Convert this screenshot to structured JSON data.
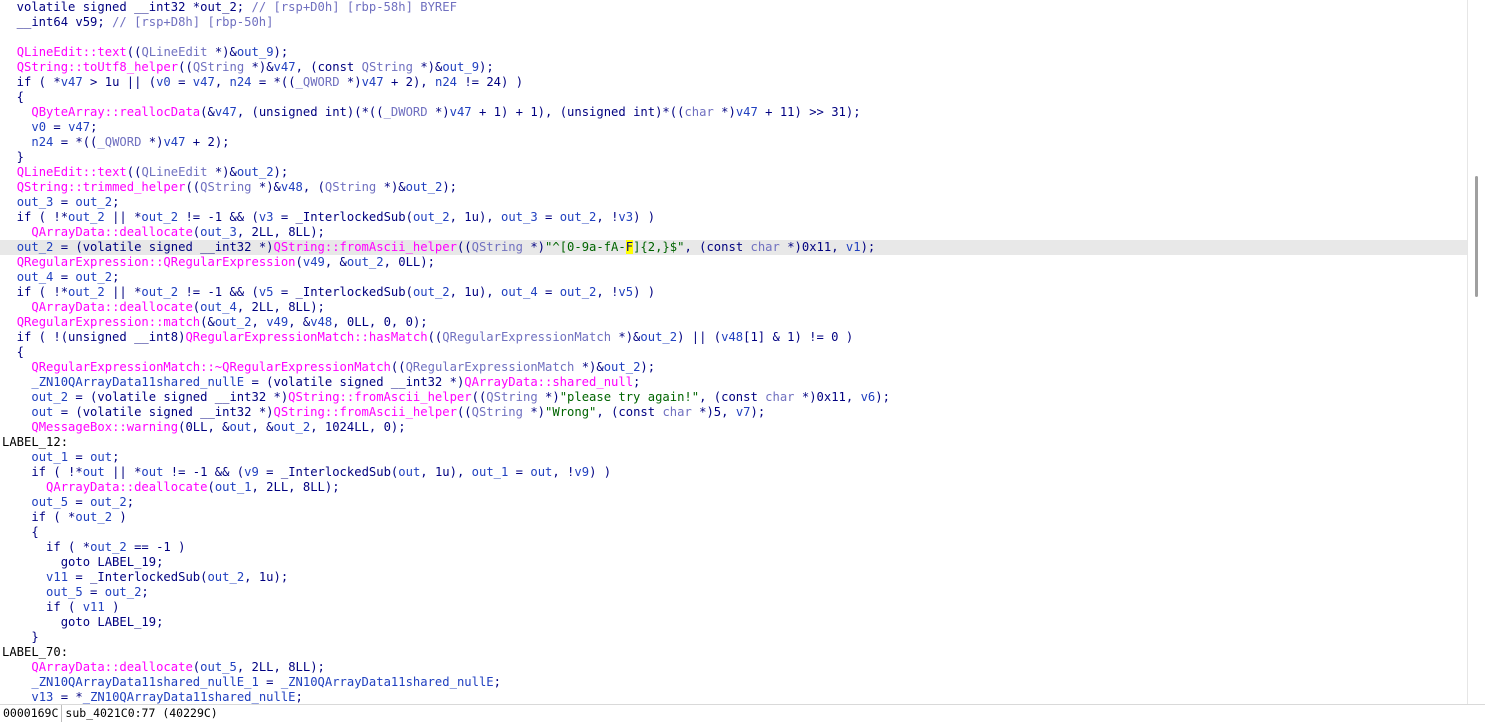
{
  "code": {
    "highlight_line": 16,
    "lines": [
      [
        [
          "  volatile signed __int32 *out_2; ",
          "p"
        ],
        [
          "// [rsp+D0h] [rbp-58h] BYREF",
          "c"
        ]
      ],
      [
        [
          "  __int64 v59; ",
          "p"
        ],
        [
          "// [rsp+D8h] [rbp-50h]",
          "c"
        ]
      ],
      [],
      [
        [
          "  ",
          "p"
        ],
        [
          "QLineEdit::text",
          "f"
        ],
        [
          "((",
          "p"
        ],
        [
          "QLineEdit",
          "c"
        ],
        [
          " *)&",
          "p"
        ],
        [
          "out_9",
          "v"
        ],
        [
          ");",
          "p"
        ]
      ],
      [
        [
          "  ",
          "p"
        ],
        [
          "QString::toUtf8_helper",
          "f"
        ],
        [
          "((",
          "p"
        ],
        [
          "QString",
          "c"
        ],
        [
          " *)&",
          "p"
        ],
        [
          "v47",
          "v"
        ],
        [
          ", (const ",
          "p"
        ],
        [
          "QString",
          "c"
        ],
        [
          " *)&",
          "p"
        ],
        [
          "out_9",
          "v"
        ],
        [
          ");",
          "p"
        ]
      ],
      [
        [
          "  if ( *",
          "k"
        ],
        [
          "v47",
          "v"
        ],
        [
          " > 1u || (",
          "p"
        ],
        [
          "v0",
          "v"
        ],
        [
          " = ",
          "p"
        ],
        [
          "v47",
          "v"
        ],
        [
          ", ",
          "p"
        ],
        [
          "n24",
          "v"
        ],
        [
          " = *((",
          "p"
        ],
        [
          "_QWORD",
          "c"
        ],
        [
          " *)",
          "p"
        ],
        [
          "v47",
          "v"
        ],
        [
          " + 2), ",
          "p"
        ],
        [
          "n24",
          "v"
        ],
        [
          " != 24) )",
          "p"
        ]
      ],
      [
        [
          "  {",
          "p"
        ]
      ],
      [
        [
          "    ",
          "p"
        ],
        [
          "QByteArray::reallocData",
          "f"
        ],
        [
          "(&",
          "p"
        ],
        [
          "v47",
          "v"
        ],
        [
          ", (unsigned int)(*((",
          "p"
        ],
        [
          "_DWORD",
          "c"
        ],
        [
          " *)",
          "p"
        ],
        [
          "v47",
          "v"
        ],
        [
          " + 1) + 1), (unsigned int)*((",
          "p"
        ],
        [
          "char",
          "c"
        ],
        [
          " *)",
          "p"
        ],
        [
          "v47",
          "v"
        ],
        [
          " + 11) >> 31);",
          "p"
        ]
      ],
      [
        [
          "    ",
          "p"
        ],
        [
          "v0",
          "v"
        ],
        [
          " = ",
          "p"
        ],
        [
          "v47",
          "v"
        ],
        [
          ";",
          "p"
        ]
      ],
      [
        [
          "    ",
          "p"
        ],
        [
          "n24",
          "v"
        ],
        [
          " = *((",
          "p"
        ],
        [
          "_QWORD",
          "c"
        ],
        [
          " *)",
          "p"
        ],
        [
          "v47",
          "v"
        ],
        [
          " + 2);",
          "p"
        ]
      ],
      [
        [
          "  }",
          "p"
        ]
      ],
      [
        [
          "  ",
          "p"
        ],
        [
          "QLineEdit::text",
          "f"
        ],
        [
          "((",
          "p"
        ],
        [
          "QLineEdit",
          "c"
        ],
        [
          " *)&",
          "p"
        ],
        [
          "out_2",
          "v"
        ],
        [
          ");",
          "p"
        ]
      ],
      [
        [
          "  ",
          "p"
        ],
        [
          "QString::trimmed_helper",
          "f"
        ],
        [
          "((",
          "p"
        ],
        [
          "QString",
          "c"
        ],
        [
          " *)&",
          "p"
        ],
        [
          "v48",
          "v"
        ],
        [
          ", (",
          "p"
        ],
        [
          "QString",
          "c"
        ],
        [
          " *)&",
          "p"
        ],
        [
          "out_2",
          "v"
        ],
        [
          ");",
          "p"
        ]
      ],
      [
        [
          "  ",
          "p"
        ],
        [
          "out_3",
          "v"
        ],
        [
          " = ",
          "p"
        ],
        [
          "out_2",
          "v"
        ],
        [
          ";",
          "p"
        ]
      ],
      [
        [
          "  if ( !*",
          "k"
        ],
        [
          "out_2",
          "v"
        ],
        [
          " || *",
          "p"
        ],
        [
          "out_2",
          "v"
        ],
        [
          " != -1 && (",
          "p"
        ],
        [
          "v3",
          "v"
        ],
        [
          " = _InterlockedSub(",
          "p"
        ],
        [
          "out_2",
          "v"
        ],
        [
          ", 1u), ",
          "p"
        ],
        [
          "out_3",
          "v"
        ],
        [
          " = ",
          "p"
        ],
        [
          "out_2",
          "v"
        ],
        [
          ", !",
          "p"
        ],
        [
          "v3",
          "v"
        ],
        [
          ") )",
          "p"
        ]
      ],
      [
        [
          "    ",
          "p"
        ],
        [
          "QArrayData::deallocate",
          "f"
        ],
        [
          "(",
          "p"
        ],
        [
          "out_3",
          "v"
        ],
        [
          ", 2LL, 8LL);",
          "p"
        ]
      ],
      [
        [
          "  ",
          "p"
        ],
        [
          "out_2",
          "v"
        ],
        [
          " = (volatile signed __int32 *)",
          "p"
        ],
        [
          "QString::fromAscii_helper",
          "f"
        ],
        [
          "((",
          "p"
        ],
        [
          "QString",
          "c"
        ],
        [
          " *)",
          "p"
        ],
        [
          "\"^[0-9a-fA-",
          "s"
        ],
        [
          "F",
          "y"
        ],
        [
          "]{2,}$\"",
          "s"
        ],
        [
          ", (const ",
          "p"
        ],
        [
          "char",
          "c"
        ],
        [
          " *)0x11, ",
          "p"
        ],
        [
          "v1",
          "v"
        ],
        [
          ");",
          "p"
        ]
      ],
      [
        [
          "  ",
          "p"
        ],
        [
          "QRegularExpression::QRegularExpression",
          "f"
        ],
        [
          "(",
          "p"
        ],
        [
          "v49",
          "v"
        ],
        [
          ", &",
          "p"
        ],
        [
          "out_2",
          "v"
        ],
        [
          ", 0LL);",
          "p"
        ]
      ],
      [
        [
          "  ",
          "p"
        ],
        [
          "out_4",
          "v"
        ],
        [
          " = ",
          "p"
        ],
        [
          "out_2",
          "v"
        ],
        [
          ";",
          "p"
        ]
      ],
      [
        [
          "  if ( !*",
          "k"
        ],
        [
          "out_2",
          "v"
        ],
        [
          " || *",
          "p"
        ],
        [
          "out_2",
          "v"
        ],
        [
          " != -1 && (",
          "p"
        ],
        [
          "v5",
          "v"
        ],
        [
          " = _InterlockedSub(",
          "p"
        ],
        [
          "out_2",
          "v"
        ],
        [
          ", 1u), ",
          "p"
        ],
        [
          "out_4",
          "v"
        ],
        [
          " = ",
          "p"
        ],
        [
          "out_2",
          "v"
        ],
        [
          ", !",
          "p"
        ],
        [
          "v5",
          "v"
        ],
        [
          ") )",
          "p"
        ]
      ],
      [
        [
          "    ",
          "p"
        ],
        [
          "QArrayData::deallocate",
          "f"
        ],
        [
          "(",
          "p"
        ],
        [
          "out_4",
          "v"
        ],
        [
          ", 2LL, 8LL);",
          "p"
        ]
      ],
      [
        [
          "  ",
          "p"
        ],
        [
          "QRegularExpression::match",
          "f"
        ],
        [
          "(&",
          "p"
        ],
        [
          "out_2",
          "v"
        ],
        [
          ", ",
          "p"
        ],
        [
          "v49",
          "v"
        ],
        [
          ", &",
          "p"
        ],
        [
          "v48",
          "v"
        ],
        [
          ", 0LL, 0, 0);",
          "p"
        ]
      ],
      [
        [
          "  if ( !(unsigned __int8)",
          "k"
        ],
        [
          "QRegularExpressionMatch::hasMatch",
          "f"
        ],
        [
          "((",
          "p"
        ],
        [
          "QRegularExpressionMatch",
          "c"
        ],
        [
          " *)&",
          "p"
        ],
        [
          "out_2",
          "v"
        ],
        [
          ") || (",
          "p"
        ],
        [
          "v48",
          "v"
        ],
        [
          "[1] & 1) != 0 )",
          "p"
        ]
      ],
      [
        [
          "  {",
          "p"
        ]
      ],
      [
        [
          "    ",
          "p"
        ],
        [
          "QRegularExpressionMatch::~QRegularExpressionMatch",
          "f"
        ],
        [
          "((",
          "p"
        ],
        [
          "QRegularExpressionMatch",
          "c"
        ],
        [
          " *)&",
          "p"
        ],
        [
          "out_2",
          "v"
        ],
        [
          ");",
          "p"
        ]
      ],
      [
        [
          "    ",
          "p"
        ],
        [
          "_ZN10QArrayData11shared_nullE",
          "v"
        ],
        [
          " = (volatile signed __int32 *)",
          "p"
        ],
        [
          "QArrayData::shared_null",
          "f"
        ],
        [
          ";",
          "p"
        ]
      ],
      [
        [
          "    ",
          "p"
        ],
        [
          "out_2",
          "v"
        ],
        [
          " = (volatile signed __int32 *)",
          "p"
        ],
        [
          "QString::fromAscii_helper",
          "f"
        ],
        [
          "((",
          "p"
        ],
        [
          "QString",
          "c"
        ],
        [
          " *)",
          "p"
        ],
        [
          "\"please try again!\"",
          "s"
        ],
        [
          ", (const ",
          "p"
        ],
        [
          "char",
          "c"
        ],
        [
          " *)0x11, ",
          "p"
        ],
        [
          "v6",
          "v"
        ],
        [
          ");",
          "p"
        ]
      ],
      [
        [
          "    ",
          "p"
        ],
        [
          "out",
          "v"
        ],
        [
          " = (volatile signed __int32 *)",
          "p"
        ],
        [
          "QString::fromAscii_helper",
          "f"
        ],
        [
          "((",
          "p"
        ],
        [
          "QString",
          "c"
        ],
        [
          " *)",
          "p"
        ],
        [
          "\"Wrong\"",
          "s"
        ],
        [
          ", (const ",
          "p"
        ],
        [
          "char",
          "c"
        ],
        [
          " *)5, ",
          "p"
        ],
        [
          "v7",
          "v"
        ],
        [
          ");",
          "p"
        ]
      ],
      [
        [
          "    ",
          "p"
        ],
        [
          "QMessageBox::warning",
          "f"
        ],
        [
          "(0LL, &",
          "p"
        ],
        [
          "out",
          "v"
        ],
        [
          ", &",
          "p"
        ],
        [
          "out_2",
          "v"
        ],
        [
          ", 1024LL, 0);",
          "p"
        ]
      ],
      [
        [
          "LABEL_12:",
          "l"
        ]
      ],
      [
        [
          "    ",
          "p"
        ],
        [
          "out_1",
          "v"
        ],
        [
          " = ",
          "p"
        ],
        [
          "out",
          "v"
        ],
        [
          ";",
          "p"
        ]
      ],
      [
        [
          "    if ( !*",
          "k"
        ],
        [
          "out",
          "v"
        ],
        [
          " || *",
          "p"
        ],
        [
          "out",
          "v"
        ],
        [
          " != -1 && (",
          "p"
        ],
        [
          "v9",
          "v"
        ],
        [
          " = _InterlockedSub(",
          "p"
        ],
        [
          "out",
          "v"
        ],
        [
          ", 1u), ",
          "p"
        ],
        [
          "out_1",
          "v"
        ],
        [
          " = ",
          "p"
        ],
        [
          "out",
          "v"
        ],
        [
          ", !",
          "p"
        ],
        [
          "v9",
          "v"
        ],
        [
          ") )",
          "p"
        ]
      ],
      [
        [
          "      ",
          "p"
        ],
        [
          "QArrayData::deallocate",
          "f"
        ],
        [
          "(",
          "p"
        ],
        [
          "out_1",
          "v"
        ],
        [
          ", 2LL, 8LL);",
          "p"
        ]
      ],
      [
        [
          "    ",
          "p"
        ],
        [
          "out_5",
          "v"
        ],
        [
          " = ",
          "p"
        ],
        [
          "out_2",
          "v"
        ],
        [
          ";",
          "p"
        ]
      ],
      [
        [
          "    if ( *",
          "k"
        ],
        [
          "out_2",
          "v"
        ],
        [
          " )",
          "p"
        ]
      ],
      [
        [
          "    {",
          "p"
        ]
      ],
      [
        [
          "      if ( *",
          "k"
        ],
        [
          "out_2",
          "v"
        ],
        [
          " == -1 )",
          "p"
        ]
      ],
      [
        [
          "        goto LABEL_19;",
          "k"
        ]
      ],
      [
        [
          "      ",
          "p"
        ],
        [
          "v11",
          "v"
        ],
        [
          " = _InterlockedSub(",
          "p"
        ],
        [
          "out_2",
          "v"
        ],
        [
          ", 1u);",
          "p"
        ]
      ],
      [
        [
          "      ",
          "p"
        ],
        [
          "out_5",
          "v"
        ],
        [
          " = ",
          "p"
        ],
        [
          "out_2",
          "v"
        ],
        [
          ";",
          "p"
        ]
      ],
      [
        [
          "      if ( ",
          "k"
        ],
        [
          "v11",
          "v"
        ],
        [
          " )",
          "p"
        ]
      ],
      [
        [
          "        goto LABEL_19;",
          "k"
        ]
      ],
      [
        [
          "    }",
          "p"
        ]
      ],
      [
        [
          "LABEL_70:",
          "l"
        ]
      ],
      [
        [
          "    ",
          "p"
        ],
        [
          "QArrayData::deallocate",
          "f"
        ],
        [
          "(",
          "p"
        ],
        [
          "out_5",
          "v"
        ],
        [
          ", 2LL, 8LL);",
          "p"
        ]
      ],
      [
        [
          "    ",
          "p"
        ],
        [
          "_ZN10QArrayData11shared_nullE_1",
          "v"
        ],
        [
          " = ",
          "p"
        ],
        [
          "_ZN10QArrayData11shared_nullE",
          "v"
        ],
        [
          ";",
          "p"
        ]
      ],
      [
        [
          "    ",
          "p"
        ],
        [
          "v13",
          "v"
        ],
        [
          " = *",
          "p"
        ],
        [
          "_ZN10QArrayData11shared_nullE",
          "v"
        ],
        [
          ";",
          "p"
        ]
      ]
    ]
  },
  "status": {
    "address": "0000169C",
    "location": "sub_4021C0:77 (40229C)"
  }
}
